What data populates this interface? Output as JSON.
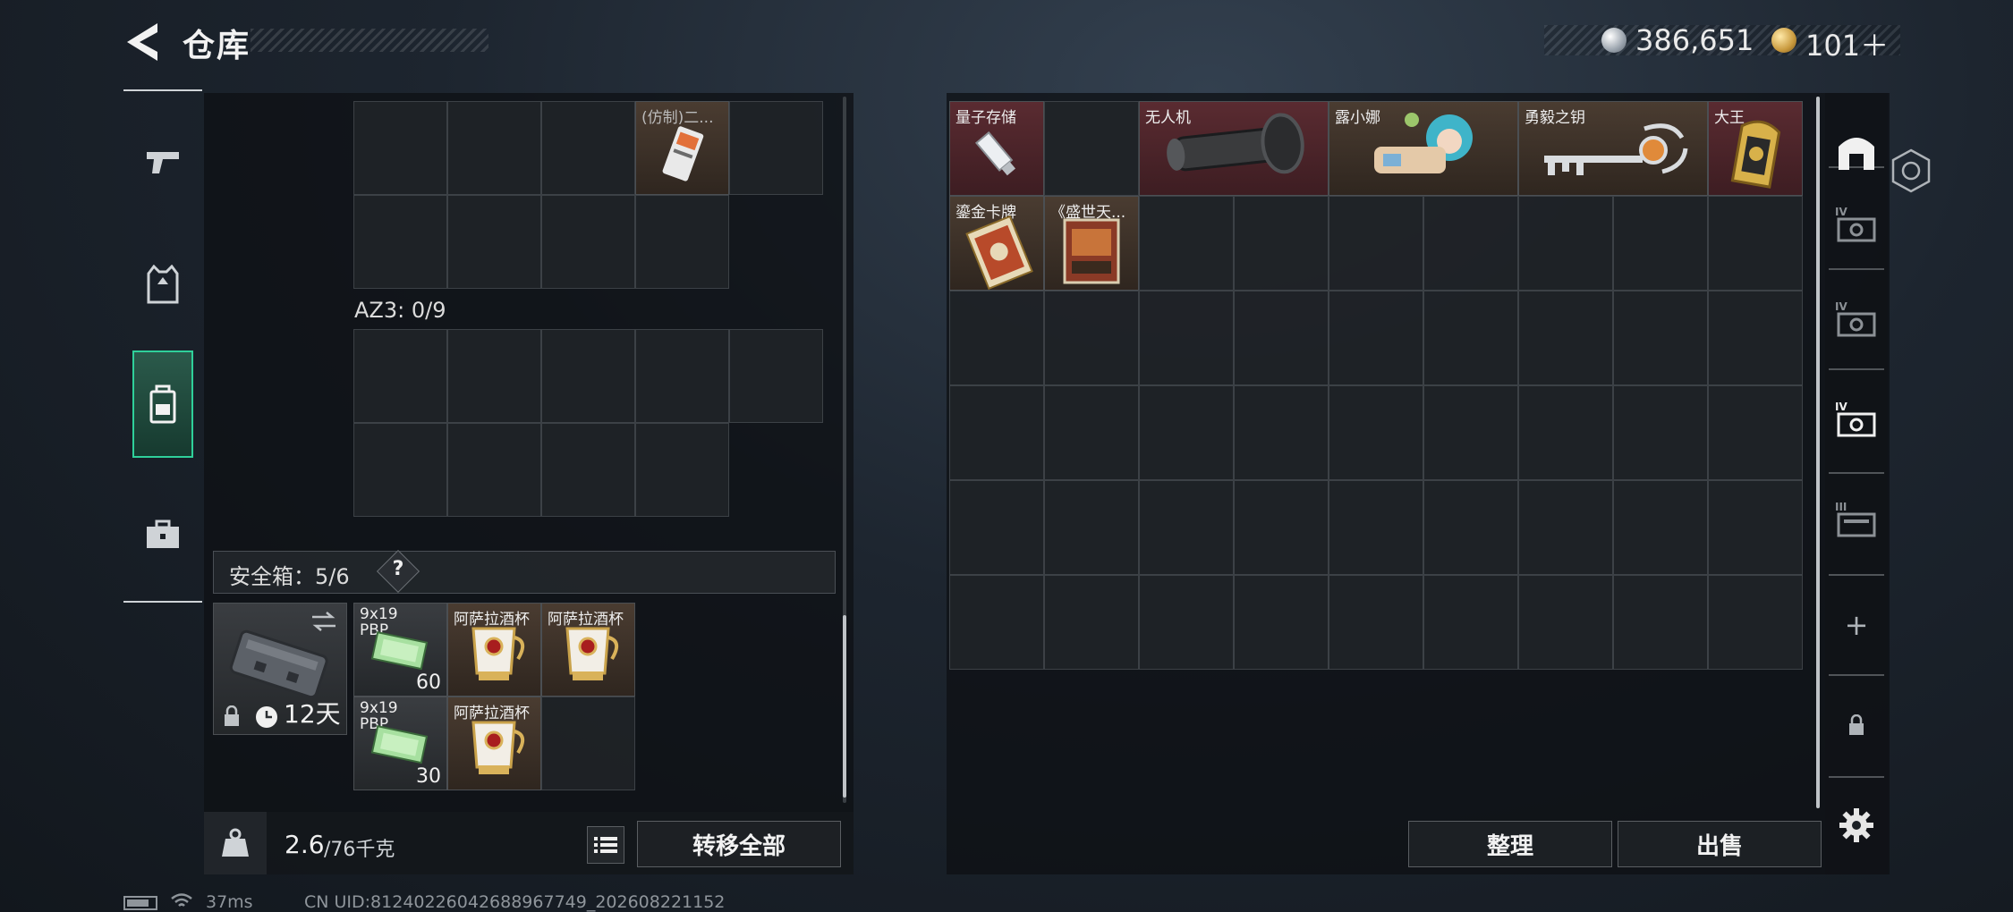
{
  "header": {
    "title": "仓库",
    "back_icon": "chevron-left-icon",
    "currency_silver": "386,651",
    "currency_gold": "101＋"
  },
  "left_tabs": [
    {
      "name": "weapon",
      "icon": "pistol-icon"
    },
    {
      "name": "armor",
      "icon": "vest-icon"
    },
    {
      "name": "backpack",
      "icon": "backpack-icon",
      "active": true
    },
    {
      "name": "case",
      "icon": "briefcase-icon"
    }
  ],
  "left_panel": {
    "top_item_label": "(仿制)二...",
    "az3_label": "AZ3: 0/9",
    "safe_box_label": "安全箱：5/6",
    "safe_box_help": "?",
    "safe_box_timer": "12天",
    "safe_items": [
      {
        "label": "9x19 PBP",
        "count": "60"
      },
      {
        "label": "阿萨拉酒杯",
        "count": ""
      },
      {
        "label": "阿萨拉酒杯",
        "count": ""
      },
      {
        "label": "9x19 PBP",
        "count": "30"
      },
      {
        "label": "阿萨拉酒杯",
        "count": ""
      }
    ],
    "weight_value": "2.6",
    "weight_total": "/76千克",
    "transfer_all_label": "转移全部"
  },
  "right_panel": {
    "items": [
      {
        "label": "量子存储",
        "color": "red"
      },
      {
        "label": "无人机",
        "color": "red"
      },
      {
        "label": "露小娜",
        "color": "brown"
      },
      {
        "label": "勇毅之钥",
        "color": "brown"
      },
      {
        "label": "大王",
        "color": "red"
      },
      {
        "label": "鎏金卡牌",
        "color": "brown"
      },
      {
        "label": "《盛世天...",
        "color": "brown"
      }
    ],
    "sort_label": "整理",
    "sell_label": "出售"
  },
  "right_tabs": [
    {
      "name": "home",
      "icon": "arch-icon"
    },
    {
      "name": "storage-iv-1",
      "icon": "storage-iv-icon",
      "tier": "IV"
    },
    {
      "name": "storage-iv-2",
      "icon": "storage-iv-icon",
      "tier": "IV"
    },
    {
      "name": "storage-iv-3",
      "icon": "storage-iv-icon",
      "tier": "IV",
      "active": true
    },
    {
      "name": "storage-iii",
      "icon": "storage-iii-icon",
      "tier": "III"
    },
    {
      "name": "add",
      "icon": "plus-icon",
      "glyph": "+"
    },
    {
      "name": "locked",
      "icon": "lock-icon"
    },
    {
      "name": "settings",
      "icon": "gear-icon"
    }
  ],
  "status_bar": {
    "ping": "37ms",
    "uid": "CN UID:812402260426889677​49_202608221152"
  }
}
